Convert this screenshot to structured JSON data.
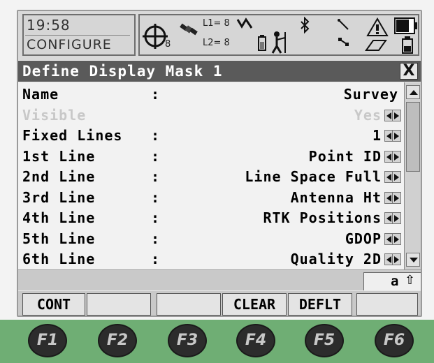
{
  "status": {
    "time": "19:58",
    "mode": "CONFIGURE",
    "satellites": "8",
    "l1_label": "L1= 8",
    "l2_label": "L2= 8"
  },
  "title": "Define Display Mask 1",
  "close_label": "X",
  "rows": [
    {
      "label": "Name",
      "colon": ":",
      "value": "Survey",
      "arrows": false,
      "disabled": false
    },
    {
      "label": "Visible",
      "colon": "",
      "value": "Yes",
      "arrows": true,
      "disabled": true
    },
    {
      "label": "Fixed Lines",
      "colon": ":",
      "value": "1",
      "arrows": true,
      "disabled": false
    },
    {
      "label": "1st Line",
      "colon": ":",
      "value": "Point ID",
      "arrows": true,
      "disabled": false
    },
    {
      "label": "2nd Line",
      "colon": ":",
      "value": "Line Space Full",
      "arrows": true,
      "disabled": false
    },
    {
      "label": "3rd Line",
      "colon": ":",
      "value": "Antenna Ht",
      "arrows": true,
      "disabled": false
    },
    {
      "label": "4th Line",
      "colon": ":",
      "value": "RTK Positions",
      "arrows": true,
      "disabled": false
    },
    {
      "label": "5th Line",
      "colon": ":",
      "value": "GDOP",
      "arrows": true,
      "disabled": false
    },
    {
      "label": "6th Line",
      "colon": ":",
      "value": "Quality 2D",
      "arrows": true,
      "disabled": false
    }
  ],
  "input_mode": {
    "char": "a",
    "shift": "⇧"
  },
  "softkeys": [
    "CONT",
    "",
    "",
    "CLEAR",
    "DEFLT",
    ""
  ],
  "function_keys": [
    "F1",
    "F2",
    "F3",
    "F4",
    "F5",
    "F6"
  ]
}
